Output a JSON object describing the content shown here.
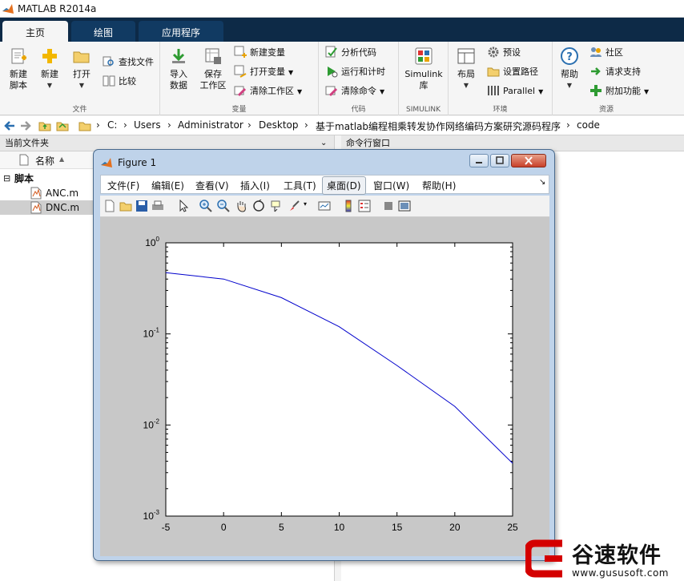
{
  "app": {
    "title": "MATLAB R2014a"
  },
  "tabs": [
    {
      "label": "主页"
    },
    {
      "label": "绘图"
    },
    {
      "label": "应用程序"
    }
  ],
  "ribbon": {
    "file": {
      "title": "文件",
      "new_script": "新建\n脚本",
      "new": "新建",
      "open": "打开",
      "find_files": "查找文件",
      "compare": "比较"
    },
    "variable": {
      "title": "变量",
      "import_data": "导入\n数据",
      "save_workspace": "保存\n工作区",
      "new_variable": "新建变量",
      "open_variable": "打开变量",
      "clear_workspace": "清除工作区"
    },
    "code": {
      "title": "代码",
      "analyze_code": "分析代码",
      "run_and_time": "运行和计时",
      "clear_commands": "清除命令"
    },
    "simulink": {
      "title": "SIMULINK",
      "simulink": "Simulink\n库"
    },
    "environment": {
      "title": "环境",
      "layout": "布局",
      "preferences": "预设",
      "set_path": "设置路径",
      "parallel": "Parallel"
    },
    "resources": {
      "title": "资源",
      "help": "帮助",
      "community": "社区",
      "request_support": "请求支持",
      "addons": "附加功能"
    }
  },
  "path": {
    "segments": [
      "C:",
      "Users",
      "Administrator",
      "Desktop",
      "基于matlab编程相乘转发协作网络编码方案研究源码程序",
      "code"
    ]
  },
  "current_folder": {
    "header": "当前文件夹",
    "column_name": "名称",
    "group": "脚本",
    "files": [
      {
        "name": "ANC.m"
      },
      {
        "name": "DNC.m"
      }
    ]
  },
  "command_window": {
    "header": "命令行窗口"
  },
  "figure": {
    "title": "Figure 1",
    "menu": [
      {
        "label": "文件(F)"
      },
      {
        "label": "编辑(E)"
      },
      {
        "label": "查看(V)"
      },
      {
        "label": "插入(I)"
      },
      {
        "label": "工具(T)"
      },
      {
        "label": "桌面(D)"
      },
      {
        "label": "窗口(W)"
      },
      {
        "label": "帮助(H)"
      }
    ]
  },
  "chart_data": {
    "type": "line",
    "title": "",
    "xlabel": "",
    "ylabel": "",
    "yscale": "log",
    "xlim": [
      -5,
      25
    ],
    "ylim": [
      0.001,
      1
    ],
    "x_ticks": [
      "-5",
      "0",
      "5",
      "10",
      "15",
      "20",
      "25"
    ],
    "y_ticks": [
      {
        "base": "10",
        "exp": "0"
      },
      {
        "base": "10",
        "exp": "-1"
      },
      {
        "base": "10",
        "exp": "-2"
      },
      {
        "base": "10",
        "exp": "-3"
      }
    ],
    "grid": false,
    "series": [
      {
        "color": "#0000cc",
        "x": [
          -5,
          0,
          5,
          10,
          15,
          20,
          25
        ],
        "y": [
          0.47,
          0.4,
          0.25,
          0.12,
          0.045,
          0.016,
          0.0038
        ]
      }
    ]
  },
  "watermark": {
    "name": "谷速软件",
    "url": "www.gususoft.com"
  }
}
